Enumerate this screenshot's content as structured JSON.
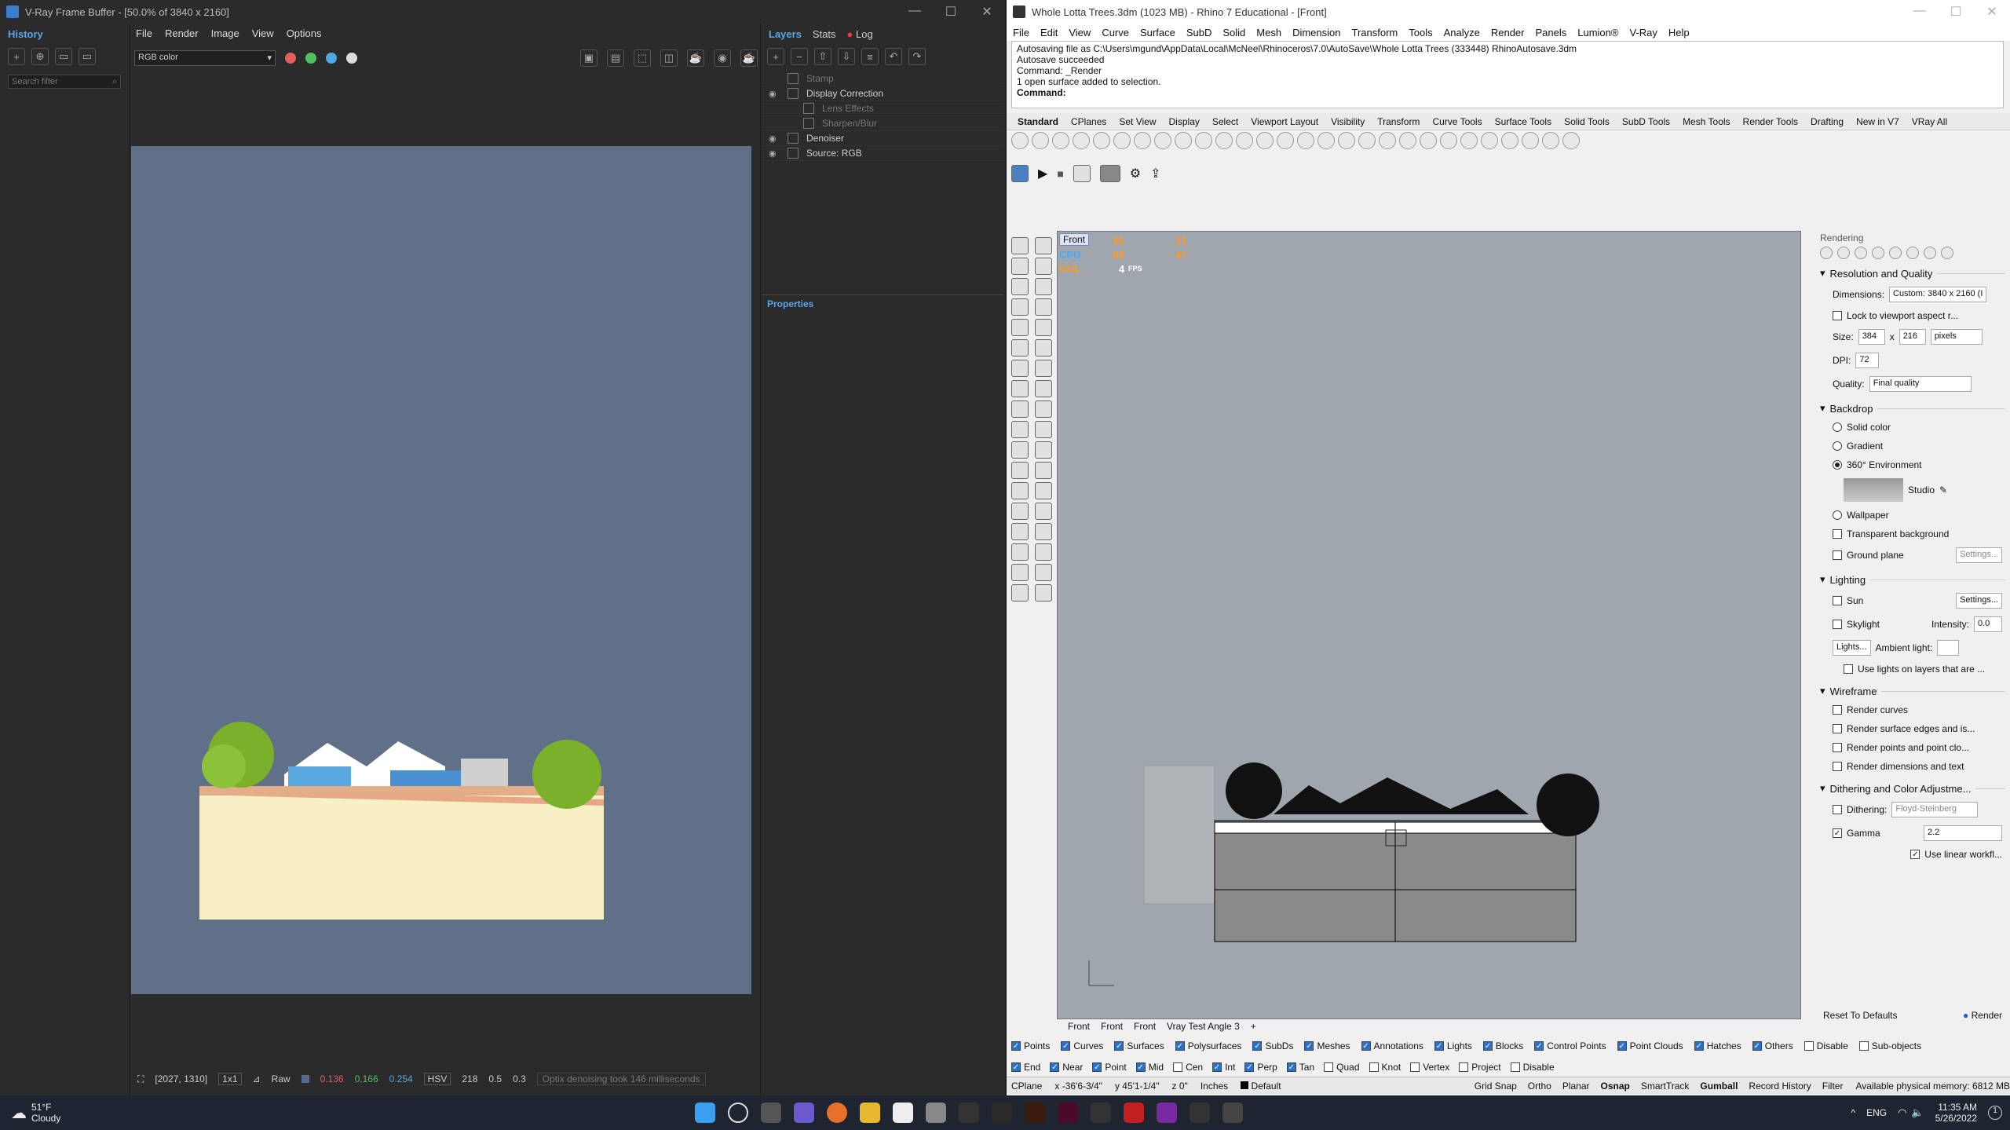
{
  "vfb": {
    "title": "V-Ray Frame Buffer - [50.0% of 3840 x 2160]",
    "history_tab": "History",
    "search_placeholder": "Search filter",
    "menu": [
      "File",
      "Render",
      "Image",
      "View",
      "Options"
    ],
    "channel": "RGB color",
    "layers_tabs": [
      "Layers",
      "Stats",
      "Log"
    ],
    "layers": [
      {
        "name": "Stamp",
        "dim": true
      },
      {
        "name": "Display Correction",
        "dim": false
      },
      {
        "name": "Lens Effects",
        "dim": true
      },
      {
        "name": "Sharpen/Blur",
        "dim": true
      },
      {
        "name": "Denoiser",
        "dim": false
      },
      {
        "name": "Source: RGB",
        "dim": false
      }
    ],
    "properties": "Properties",
    "status": {
      "coords": "[2027, 1310]",
      "zoom": "1x1",
      "mode": "Raw",
      "r": "0.136",
      "g": "0.166",
      "b": "0.254",
      "space": "HSV",
      "h": "218",
      "s": "0.5",
      "v": "0.3",
      "msg": "Optix denoising took 146 milliseconds"
    }
  },
  "rhino": {
    "title": "Whole Lotta Trees.3dm (1023 MB) - Rhino 7 Educational - [Front]",
    "menu": [
      "File",
      "Edit",
      "View",
      "Curve",
      "Surface",
      "SubD",
      "Solid",
      "Mesh",
      "Dimension",
      "Transform",
      "Tools",
      "Analyze",
      "Render",
      "Panels",
      "Lumion®",
      "V-Ray",
      "Help"
    ],
    "cmd_lines": [
      "Autosaving file as C:\\Users\\mgund\\AppData\\Local\\McNeel\\Rhinoceros\\7.0\\AutoSave\\Whole Lotta Trees (333448) RhinoAutosave.3dm",
      "Autosave succeeded",
      "Command: _Render",
      "1 open surface added to selection."
    ],
    "cmd_prompt": "Command:",
    "tabs": [
      "Standard",
      "CPlanes",
      "Set View",
      "Display",
      "Select",
      "Viewport Layout",
      "Visibility",
      "Transform",
      "Curve Tools",
      "Surface Tools",
      "Solid Tools",
      "SubD Tools",
      "Mesh Tools",
      "Render Tools",
      "Drafting",
      "New in V7",
      "VRay All"
    ],
    "viewport": {
      "name": "Front",
      "hud": [
        "46",
        "21",
        "CPU",
        "69",
        "47",
        "OGL",
        "4",
        "FPS"
      ]
    },
    "view_tabs": [
      "Front",
      "Front",
      "Front",
      "Vray Test Angle 3"
    ],
    "panel": {
      "title": "Rendering",
      "res": "Resolution and Quality",
      "dimensions_label": "Dimensions:",
      "dimensions": "Custom: 3840 x 2160 (I",
      "lock": "Lock to viewport aspect r...",
      "size_label": "Size:",
      "w": "384",
      "h": "216",
      "unit": "pixels",
      "dpi_label": "DPI:",
      "dpi": "72",
      "quality_label": "Quality:",
      "quality": "Final quality",
      "backdrop": "Backdrop",
      "bd_opts": [
        "Solid color",
        "Gradient",
        "360° Environment"
      ],
      "env": "Studio",
      "wallpaper": "Wallpaper",
      "transparent": "Transparent background",
      "ground": "Ground plane",
      "settings": "Settings...",
      "lighting": "Lighting",
      "sun": "Sun",
      "skylight": "Skylight",
      "intensity_label": "Intensity:",
      "intensity": "0.0",
      "lights": "Lights...",
      "ambient": "Ambient light:",
      "use_lights": "Use lights on layers that are ...",
      "wireframe": "Wireframe",
      "wf": [
        "Render curves",
        "Render surface edges and is...",
        "Render points and point clo...",
        "Render dimensions and text"
      ],
      "dither_sec": "Dithering and Color Adjustme...",
      "dithering": "Dithering:",
      "dither_val": "Floyd-Steinberg",
      "gamma": "Gamma",
      "gamma_val": "2.2",
      "linear": "Use linear workfl...",
      "reset": "Reset To Defaults",
      "render": "Render"
    },
    "filters": [
      "Points",
      "Curves",
      "Surfaces",
      "Polysurfaces",
      "SubDs",
      "Meshes",
      "Annotations",
      "Lights",
      "Blocks",
      "Control Points",
      "Point Clouds",
      "Hatches",
      "Others",
      "Disable",
      "Sub-objects"
    ],
    "osnaps": [
      "End",
      "Near",
      "Point",
      "Mid",
      "Cen",
      "Int",
      "Perp",
      "Tan",
      "Quad",
      "Knot",
      "Vertex",
      "Project",
      "Disable"
    ],
    "status": {
      "cplane": "CPlane",
      "x": "x -36'6-3/4\"",
      "y": "y 45'1-1/4\"",
      "z": "z 0\"",
      "units": "Inches",
      "layer": "Default",
      "items": [
        "Grid Snap",
        "Ortho",
        "Planar",
        "Osnap",
        "SmartTrack",
        "Gumball",
        "Record History",
        "Filter"
      ],
      "mem": "Available physical memory: 6812 MB"
    }
  },
  "taskbar": {
    "temp": "51°F",
    "weather": "Cloudy",
    "lang": "ENG",
    "time": "11:35 AM",
    "date": "5/26/2022"
  }
}
